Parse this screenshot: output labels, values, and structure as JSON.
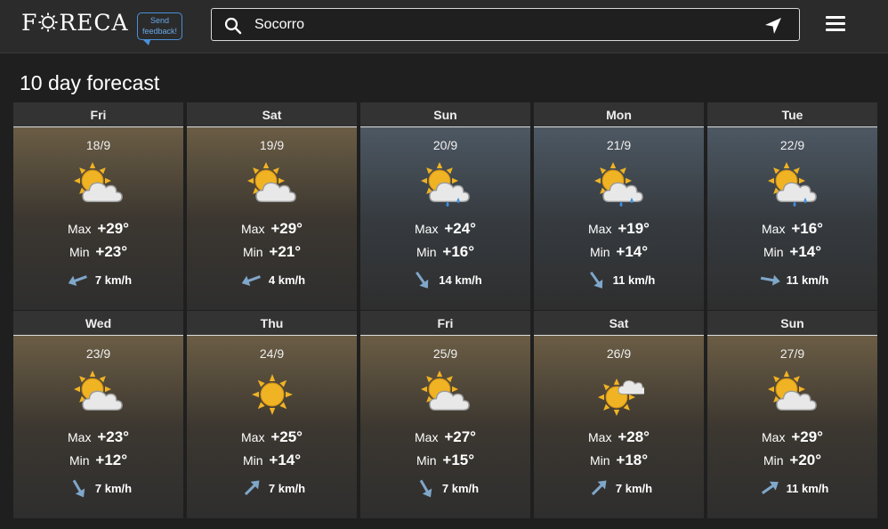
{
  "header": {
    "logo": "FORECA",
    "feedback_label": "Send feedback!",
    "search_value": "Socorro",
    "search_icon": "search-icon",
    "location_icon": "location-arrow-icon",
    "menu_icon": "hamburger-menu-icon"
  },
  "page_title": "10 day forecast",
  "days": [
    {
      "weekday": "Fri",
      "date": "18/9",
      "icon": "partly-cloudy",
      "max": "+29°",
      "min": "+23°",
      "wind": "7 km/h",
      "wind_dir": 250,
      "tone": "warm"
    },
    {
      "weekday": "Sat",
      "date": "19/9",
      "icon": "partly-cloudy",
      "max": "+29°",
      "min": "+21°",
      "wind": "4 km/h",
      "wind_dir": 250,
      "tone": "warm"
    },
    {
      "weekday": "Sun",
      "date": "20/9",
      "icon": "partly-cloudy-showers",
      "max": "+24°",
      "min": "+16°",
      "wind": "14 km/h",
      "wind_dir": 145,
      "tone": "cool"
    },
    {
      "weekday": "Mon",
      "date": "21/9",
      "icon": "partly-cloudy-showers",
      "max": "+19°",
      "min": "+14°",
      "wind": "11 km/h",
      "wind_dir": 145,
      "tone": "cool"
    },
    {
      "weekday": "Tue",
      "date": "22/9",
      "icon": "partly-cloudy-showers",
      "max": "+16°",
      "min": "+14°",
      "wind": "11 km/h",
      "wind_dir": 100,
      "tone": "cool"
    },
    {
      "weekday": "Wed",
      "date": "23/9",
      "icon": "partly-cloudy",
      "max": "+23°",
      "min": "+12°",
      "wind": "7 km/h",
      "wind_dir": 150,
      "tone": "warm"
    },
    {
      "weekday": "Thu",
      "date": "24/9",
      "icon": "sunny",
      "max": "+25°",
      "min": "+14°",
      "wind": "7 km/h",
      "wind_dir": 45,
      "tone": "warm"
    },
    {
      "weekday": "Fri",
      "date": "25/9",
      "icon": "partly-cloudy",
      "max": "+27°",
      "min": "+15°",
      "wind": "7 km/h",
      "wind_dir": 150,
      "tone": "warm"
    },
    {
      "weekday": "Sat",
      "date": "26/9",
      "icon": "mostly-sunny",
      "max": "+28°",
      "min": "+18°",
      "wind": "7 km/h",
      "wind_dir": 45,
      "tone": "warm"
    },
    {
      "weekday": "Sun",
      "date": "27/9",
      "icon": "partly-cloudy",
      "max": "+29°",
      "min": "+20°",
      "wind": "11 km/h",
      "wind_dir": 55,
      "tone": "warm"
    }
  ],
  "labels": {
    "max": "Max",
    "min": "Min"
  },
  "colors": {
    "sun": "#f0b323",
    "sun_edge": "#c98a12",
    "cloud": "#e8e8e8",
    "rain": "#3d8fe0",
    "wind_arrow": "#7fa7c9"
  }
}
